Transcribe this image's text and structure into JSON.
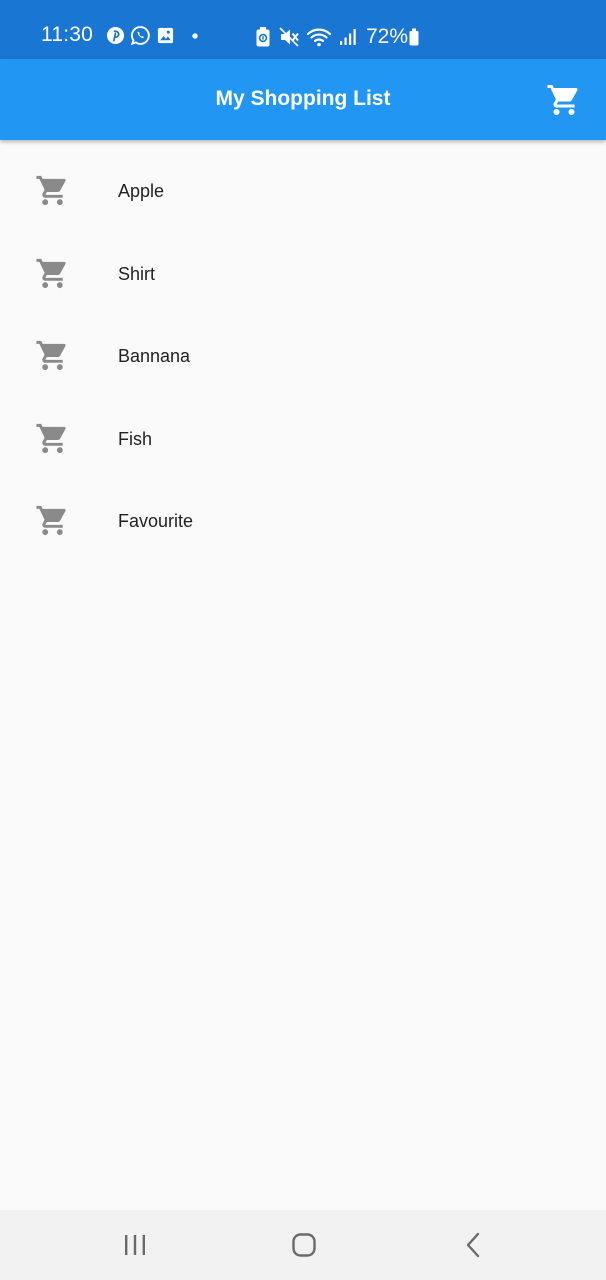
{
  "status_bar": {
    "time": "11:30",
    "battery": "72%",
    "left_icons": [
      "pinterest-icon",
      "whatsapp-icon",
      "gallery-icon",
      "notification-dot-icon"
    ],
    "right_icons": [
      "battery-saver-icon",
      "mute-icon",
      "wifi-icon",
      "signal-icon",
      "battery-icon"
    ]
  },
  "app_bar": {
    "title": "My Shopping List",
    "action_icon": "shopping-cart-icon",
    "color": "#2196f3"
  },
  "list": {
    "items": [
      {
        "label": "Apple",
        "icon": "shopping-cart-icon"
      },
      {
        "label": "Shirt",
        "icon": "shopping-cart-icon"
      },
      {
        "label": "Bannana",
        "icon": "shopping-cart-icon"
      },
      {
        "label": "Fish",
        "icon": "shopping-cart-icon"
      },
      {
        "label": "Favourite",
        "icon": "shopping-cart-icon"
      }
    ],
    "icon_color": "#8a8a8a"
  },
  "nav_bar": {
    "buttons": [
      "recent-apps-icon",
      "home-icon",
      "back-icon"
    ]
  }
}
